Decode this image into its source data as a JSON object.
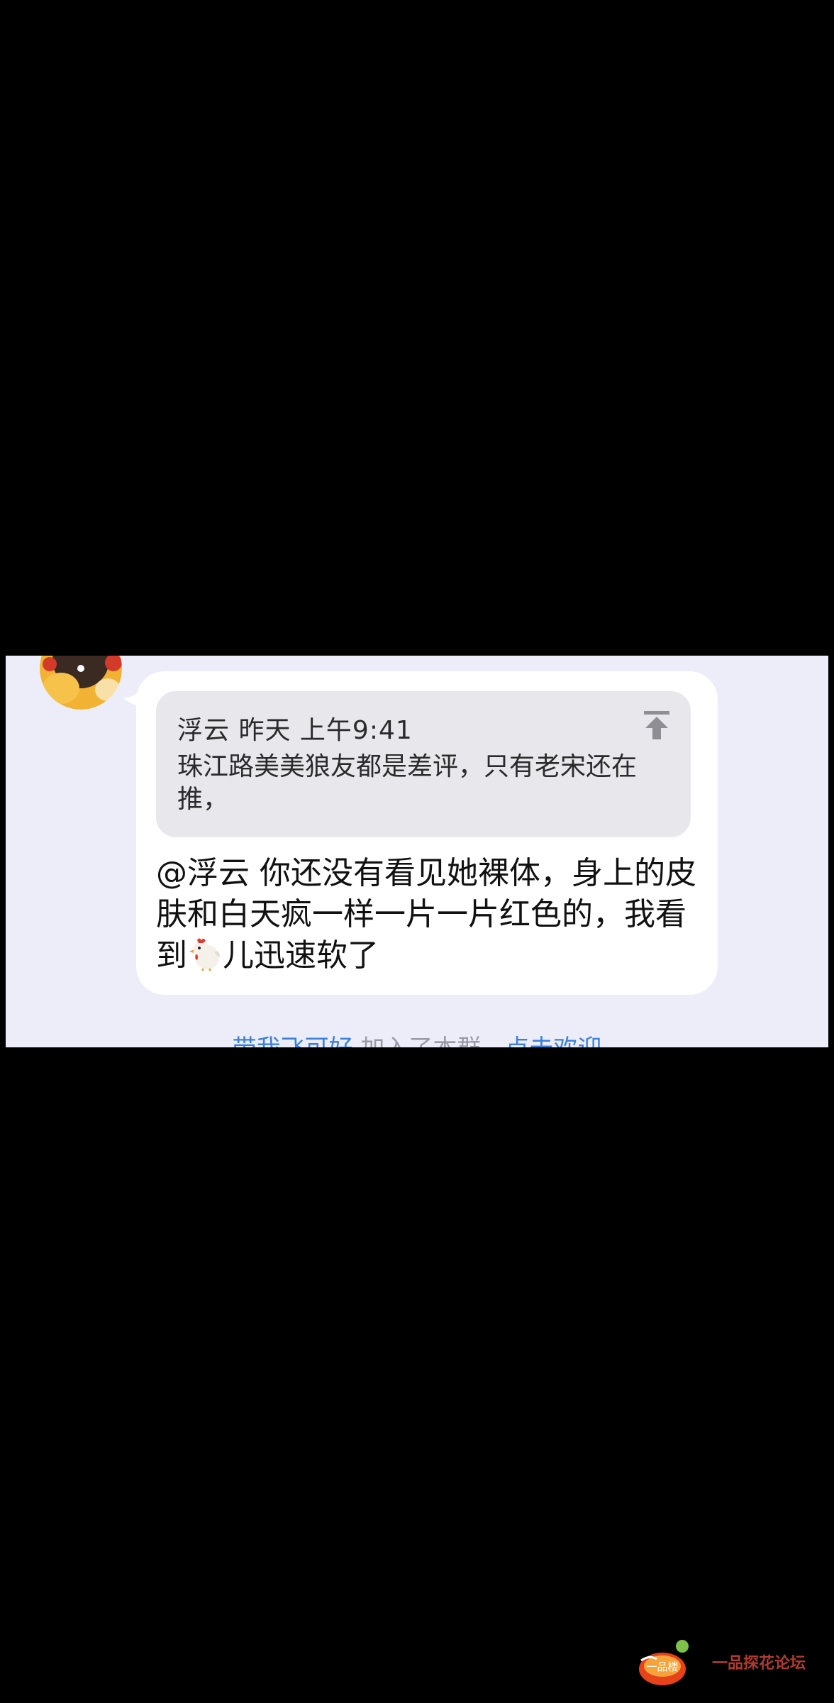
{
  "quote": {
    "sender": "浮云",
    "time": "昨天 上午9:41",
    "text": "珠江路美美狼友都是差评，只有老宋还在推，",
    "icon": "pin-to-top-icon"
  },
  "message": {
    "part1": "@浮云 你还没有看见她裸体，身上的皮肤和白天疯一样一片一片红色的，我看到",
    "emoji": "chicken-emoji-icon",
    "part2": "儿迅速软了"
  },
  "system_notice": {
    "user": "带我飞可好",
    "action": " 加入了本群，",
    "link": "点击欢迎"
  },
  "watermark": {
    "text": "一品探花论坛",
    "logo_text": "一品楼"
  },
  "colors": {
    "background": "#000000",
    "chat_background": "#ecedf8",
    "bubble": "#ffffff",
    "quote_box": "#e8e8ec",
    "link": "#3c7fd9"
  }
}
